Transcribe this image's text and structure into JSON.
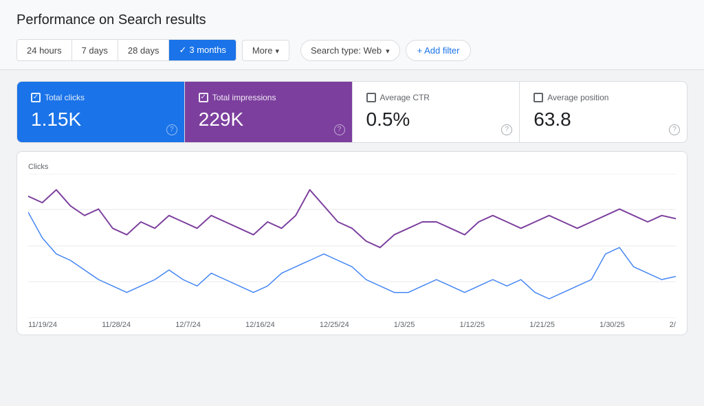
{
  "page": {
    "title": "Performance on Search results"
  },
  "toolbar": {
    "time_buttons": [
      {
        "id": "24hours",
        "label": "24 hours",
        "active": false
      },
      {
        "id": "7days",
        "label": "7 days",
        "active": false
      },
      {
        "id": "28days",
        "label": "28 days",
        "active": false
      },
      {
        "id": "3months",
        "label": "3 months",
        "active": true
      },
      {
        "id": "more",
        "label": "More",
        "active": false
      }
    ],
    "search_type_label": "Search type: Web",
    "add_filter_label": "+ Add filter"
  },
  "metrics": [
    {
      "id": "total-clicks",
      "label": "Total clicks",
      "value": "1.15K",
      "checked": true,
      "theme": "active-blue"
    },
    {
      "id": "total-impressions",
      "label": "Total impressions",
      "value": "229K",
      "checked": true,
      "theme": "active-purple"
    },
    {
      "id": "average-ctr",
      "label": "Average CTR",
      "value": "0.5%",
      "checked": false,
      "theme": "inactive"
    },
    {
      "id": "average-position",
      "label": "Average position",
      "value": "63.8",
      "checked": false,
      "theme": "inactive"
    }
  ],
  "chart": {
    "y_label": "Clicks",
    "y_max": 45,
    "y_ticks": [
      0,
      15,
      30,
      45
    ],
    "x_labels": [
      "11/19/24",
      "11/28/24",
      "12/7/24",
      "12/16/24",
      "12/25/24",
      "1/3/25",
      "1/12/25",
      "1/21/25",
      "1/30/25",
      "2/"
    ],
    "series": {
      "purple": {
        "color": "#7c3f9e",
        "points": [
          38,
          36,
          40,
          35,
          32,
          34,
          28,
          26,
          30,
          28,
          32,
          30,
          28,
          32,
          30,
          28,
          26,
          30,
          28,
          32,
          40,
          35,
          30,
          28,
          24,
          22,
          26,
          28,
          30,
          30,
          28,
          26,
          30,
          32,
          30,
          28,
          30,
          32,
          30,
          28,
          30,
          32,
          34,
          32,
          30,
          32,
          31
        ]
      },
      "blue": {
        "color": "#4285f4",
        "points": [
          33,
          25,
          20,
          18,
          15,
          12,
          10,
          8,
          10,
          12,
          15,
          12,
          10,
          14,
          12,
          10,
          8,
          10,
          14,
          16,
          18,
          20,
          18,
          16,
          12,
          10,
          8,
          8,
          10,
          12,
          10,
          8,
          10,
          12,
          10,
          12,
          8,
          6,
          8,
          10,
          12,
          20,
          22,
          16,
          14,
          12,
          13
        ]
      }
    }
  }
}
